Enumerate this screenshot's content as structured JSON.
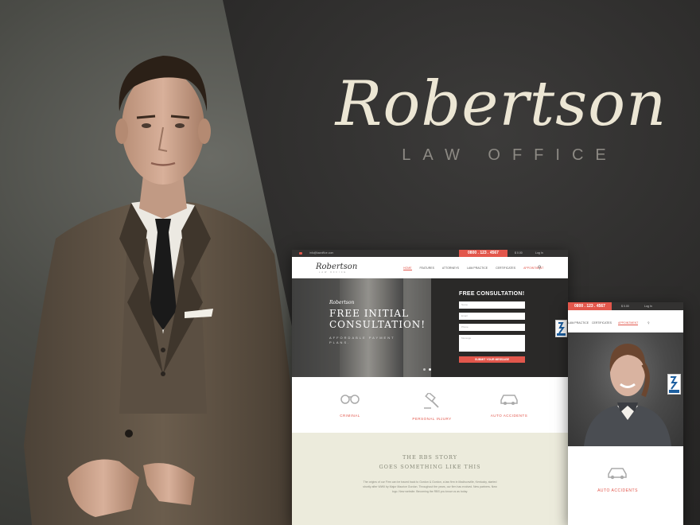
{
  "hero": {
    "title": "Robertson",
    "subtitle": "LAW OFFICE"
  },
  "desktop": {
    "topbar": {
      "email": "info@lawoffice.com",
      "phone": "0800 . 123 . 4567",
      "cart": "$ 0.00",
      "login": "Log In"
    },
    "logo": "Robertson",
    "logo_sub": "LAW OFFICE",
    "menu": [
      {
        "label": "HOME",
        "active": true
      },
      {
        "label": "FEATURES",
        "active": false
      },
      {
        "label": "ATTORNEYS",
        "active": false
      },
      {
        "label": "LAW PRACTICE",
        "active": false
      },
      {
        "label": "CERTIFICATES",
        "active": false
      },
      {
        "label": "APPOINTMENT",
        "active": false
      }
    ],
    "slide": {
      "logo": "Robertson",
      "title": "FREE INITIAL CONSULTATION!",
      "subtitle": "AFFORDABLE PAYMENT PLANS."
    },
    "form": {
      "title": "FREE CONSULTATION!",
      "name_placeholder": "Name",
      "email_placeholder": "Email",
      "phone_placeholder": "Phone",
      "message_placeholder": "Message",
      "submit": "SUBMIT YOUR MESSAGE"
    },
    "services": [
      {
        "label": "CRIMINAL",
        "icon": "handcuffs-icon"
      },
      {
        "label": "PERSONAL INJURY",
        "icon": "gavel-icon"
      },
      {
        "label": "AUTO ACCIDENTS",
        "icon": "car-icon"
      }
    ],
    "story": {
      "title_line1": "THE RBS STORY",
      "title_line2": "GOES SOMETHING LIKE THIS",
      "text": "The origins of our Firm can be traced back to Gordon & Gordon, a law firm in Madisonville, Kentucky, started shortly after WWII by Major Maurice Gordon. Throughout the years, our firm has evolved. New partners. New logo. New website. Becoming the RBS you know us as today."
    }
  },
  "tablet": {
    "phone": "0800 . 123 . 4567",
    "cart": "$ 0.00",
    "login": "Log In",
    "menu": [
      "LAW PRACTICE",
      "CERTIFICATES",
      "APPOINTMENT"
    ],
    "service": {
      "label": "AUTO ACCIDENTS",
      "icon": "car-icon"
    }
  },
  "colors": {
    "accent": "#e2574c",
    "dark": "#2a2928",
    "cream": "#ecebdc",
    "brand_text": "#ece6d4"
  }
}
